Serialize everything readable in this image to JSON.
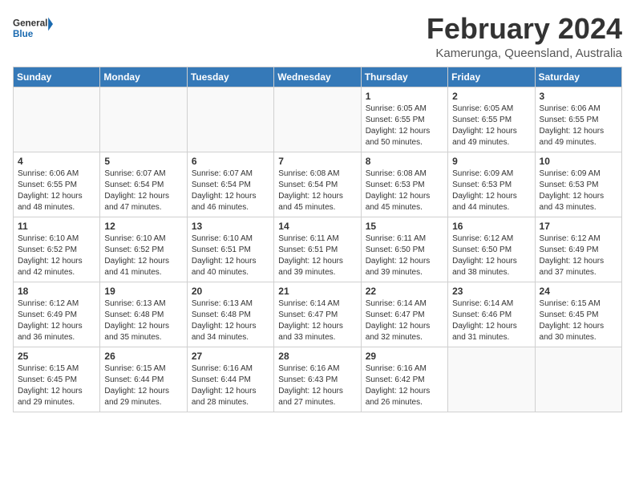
{
  "header": {
    "logo_line1": "General",
    "logo_line2": "Blue",
    "month": "February 2024",
    "location": "Kamerunga, Queensland, Australia"
  },
  "days_of_week": [
    "Sunday",
    "Monday",
    "Tuesday",
    "Wednesday",
    "Thursday",
    "Friday",
    "Saturday"
  ],
  "weeks": [
    [
      {
        "day": "",
        "info": ""
      },
      {
        "day": "",
        "info": ""
      },
      {
        "day": "",
        "info": ""
      },
      {
        "day": "",
        "info": ""
      },
      {
        "day": "1",
        "info": "Sunrise: 6:05 AM\nSunset: 6:55 PM\nDaylight: 12 hours\nand 50 minutes."
      },
      {
        "day": "2",
        "info": "Sunrise: 6:05 AM\nSunset: 6:55 PM\nDaylight: 12 hours\nand 49 minutes."
      },
      {
        "day": "3",
        "info": "Sunrise: 6:06 AM\nSunset: 6:55 PM\nDaylight: 12 hours\nand 49 minutes."
      }
    ],
    [
      {
        "day": "4",
        "info": "Sunrise: 6:06 AM\nSunset: 6:55 PM\nDaylight: 12 hours\nand 48 minutes."
      },
      {
        "day": "5",
        "info": "Sunrise: 6:07 AM\nSunset: 6:54 PM\nDaylight: 12 hours\nand 47 minutes."
      },
      {
        "day": "6",
        "info": "Sunrise: 6:07 AM\nSunset: 6:54 PM\nDaylight: 12 hours\nand 46 minutes."
      },
      {
        "day": "7",
        "info": "Sunrise: 6:08 AM\nSunset: 6:54 PM\nDaylight: 12 hours\nand 45 minutes."
      },
      {
        "day": "8",
        "info": "Sunrise: 6:08 AM\nSunset: 6:53 PM\nDaylight: 12 hours\nand 45 minutes."
      },
      {
        "day": "9",
        "info": "Sunrise: 6:09 AM\nSunset: 6:53 PM\nDaylight: 12 hours\nand 44 minutes."
      },
      {
        "day": "10",
        "info": "Sunrise: 6:09 AM\nSunset: 6:53 PM\nDaylight: 12 hours\nand 43 minutes."
      }
    ],
    [
      {
        "day": "11",
        "info": "Sunrise: 6:10 AM\nSunset: 6:52 PM\nDaylight: 12 hours\nand 42 minutes."
      },
      {
        "day": "12",
        "info": "Sunrise: 6:10 AM\nSunset: 6:52 PM\nDaylight: 12 hours\nand 41 minutes."
      },
      {
        "day": "13",
        "info": "Sunrise: 6:10 AM\nSunset: 6:51 PM\nDaylight: 12 hours\nand 40 minutes."
      },
      {
        "day": "14",
        "info": "Sunrise: 6:11 AM\nSunset: 6:51 PM\nDaylight: 12 hours\nand 39 minutes."
      },
      {
        "day": "15",
        "info": "Sunrise: 6:11 AM\nSunset: 6:50 PM\nDaylight: 12 hours\nand 39 minutes."
      },
      {
        "day": "16",
        "info": "Sunrise: 6:12 AM\nSunset: 6:50 PM\nDaylight: 12 hours\nand 38 minutes."
      },
      {
        "day": "17",
        "info": "Sunrise: 6:12 AM\nSunset: 6:49 PM\nDaylight: 12 hours\nand 37 minutes."
      }
    ],
    [
      {
        "day": "18",
        "info": "Sunrise: 6:12 AM\nSunset: 6:49 PM\nDaylight: 12 hours\nand 36 minutes."
      },
      {
        "day": "19",
        "info": "Sunrise: 6:13 AM\nSunset: 6:48 PM\nDaylight: 12 hours\nand 35 minutes."
      },
      {
        "day": "20",
        "info": "Sunrise: 6:13 AM\nSunset: 6:48 PM\nDaylight: 12 hours\nand 34 minutes."
      },
      {
        "day": "21",
        "info": "Sunrise: 6:14 AM\nSunset: 6:47 PM\nDaylight: 12 hours\nand 33 minutes."
      },
      {
        "day": "22",
        "info": "Sunrise: 6:14 AM\nSunset: 6:47 PM\nDaylight: 12 hours\nand 32 minutes."
      },
      {
        "day": "23",
        "info": "Sunrise: 6:14 AM\nSunset: 6:46 PM\nDaylight: 12 hours\nand 31 minutes."
      },
      {
        "day": "24",
        "info": "Sunrise: 6:15 AM\nSunset: 6:45 PM\nDaylight: 12 hours\nand 30 minutes."
      }
    ],
    [
      {
        "day": "25",
        "info": "Sunrise: 6:15 AM\nSunset: 6:45 PM\nDaylight: 12 hours\nand 29 minutes."
      },
      {
        "day": "26",
        "info": "Sunrise: 6:15 AM\nSunset: 6:44 PM\nDaylight: 12 hours\nand 29 minutes."
      },
      {
        "day": "27",
        "info": "Sunrise: 6:16 AM\nSunset: 6:44 PM\nDaylight: 12 hours\nand 28 minutes."
      },
      {
        "day": "28",
        "info": "Sunrise: 6:16 AM\nSunset: 6:43 PM\nDaylight: 12 hours\nand 27 minutes."
      },
      {
        "day": "29",
        "info": "Sunrise: 6:16 AM\nSunset: 6:42 PM\nDaylight: 12 hours\nand 26 minutes."
      },
      {
        "day": "",
        "info": ""
      },
      {
        "day": "",
        "info": ""
      }
    ]
  ]
}
